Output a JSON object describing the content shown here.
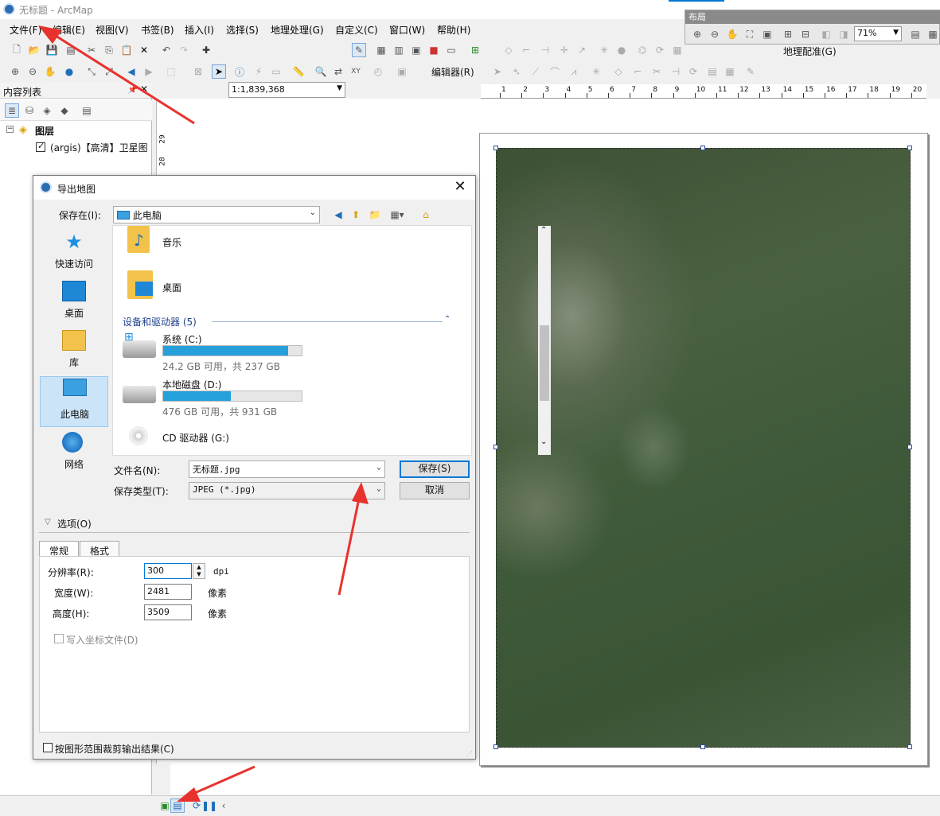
{
  "app": {
    "title": "无标题 - ArcMap"
  },
  "menu": {
    "items": [
      "文件(F)",
      "编辑(E)",
      "视图(V)",
      "书签(B)",
      "插入(I)",
      "选择(S)",
      "地理处理(G)",
      "自定义(C)",
      "窗口(W)",
      "帮助(H)"
    ]
  },
  "toolbar": {
    "scale_value": "1:1,839,368",
    "editor_label": "编辑器(R)",
    "georef_label": "地理配准(G)"
  },
  "layout_panel": {
    "title": "布局",
    "zoom_value": "71%"
  },
  "toc": {
    "title": "内容列表",
    "group_label": "图层",
    "layer_label": "(argis)【高清】卫星图",
    "ruler_ticks": [
      "29",
      "28"
    ]
  },
  "ruler": {
    "ticks": [
      "1",
      "2",
      "3",
      "4",
      "5",
      "6",
      "7",
      "8",
      "9",
      "10",
      "11",
      "12",
      "13",
      "14",
      "15",
      "16",
      "17",
      "18",
      "19",
      "20"
    ]
  },
  "dialog": {
    "title": "导出地图",
    "save_in_label": "保存在(I):",
    "save_in_value": "此电脑",
    "places": [
      "快速访问",
      "桌面",
      "库",
      "此电脑",
      "网络"
    ],
    "folders": [
      "音乐",
      "桌面"
    ],
    "devices_header": "设备和驱动器 (5)",
    "drives": [
      {
        "name": "系统 (C:)",
        "info": "24.2 GB 可用，共 237 GB",
        "used": 0.9
      },
      {
        "name": "本地磁盘 (D:)",
        "info": "476 GB 可用，共 931 GB",
        "used": 0.49
      },
      {
        "name": "CD 驱动器 (G:)"
      }
    ],
    "filename_label": "文件名(N):",
    "filename_value": "无标题.jpg",
    "filetype_label": "保存类型(T):",
    "filetype_value": "JPEG (*.jpg)",
    "save_button": "保存(S)",
    "cancel_button": "取消",
    "options_label": "选项(O)",
    "tabs": [
      "常规",
      "格式"
    ],
    "resolution_label": "分辨率(R):",
    "resolution_value": "300",
    "resolution_unit": "dpi",
    "width_label": "宽度(W):",
    "width_value": "2481",
    "height_label": "高度(H):",
    "height_value": "3509",
    "pixel_unit": "像素",
    "write_world_file_label": "写入坐标文件(D)",
    "clip_label": "按图形范围裁剪输出结果(C)"
  },
  "colors": {
    "arrow": "#e8322e",
    "accent": "#0078d7",
    "drive_fill": "#26a0da"
  }
}
